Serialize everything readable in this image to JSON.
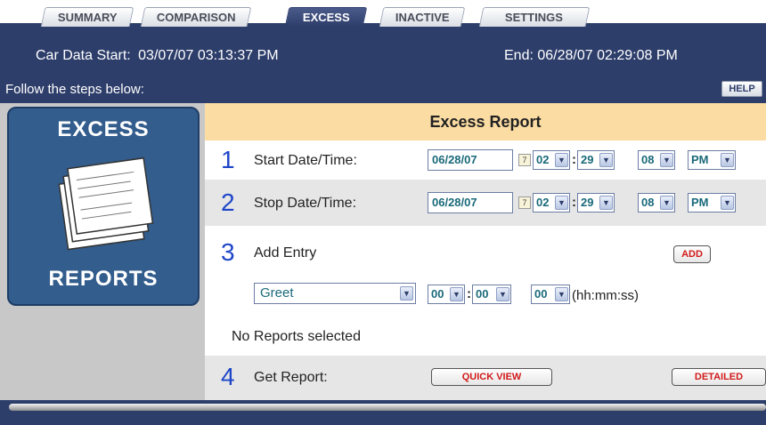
{
  "tabs": [
    {
      "label": "SUMMARY"
    },
    {
      "label": "COMPARISON"
    },
    {
      "label": "EXCESS"
    },
    {
      "label": "INACTIVE"
    },
    {
      "label": "SETTINGS"
    }
  ],
  "active_tab": "EXCESS",
  "header": {
    "car_data_start_label": "Car Data Start:",
    "car_data_start_value": "03/07/07 03:13:37 PM",
    "end_label": "End:",
    "end_value": "06/28/07 02:29:08 PM",
    "follow_text": "Follow the steps below:",
    "help_label": "HELP"
  },
  "left_card": {
    "title": "EXCESS",
    "footer": "REPORTS"
  },
  "report": {
    "title": "Excess Report",
    "steps": [
      {
        "number": "1",
        "label": "Start Date/Time:",
        "date": "06/28/07",
        "hour": "02",
        "minute": "29",
        "second": "08",
        "ampm": "PM"
      },
      {
        "number": "2",
        "label": "Stop Date/Time:",
        "date": "06/28/07",
        "hour": "02",
        "minute": "29",
        "second": "08",
        "ampm": "PM"
      },
      {
        "number": "3",
        "label": "Add Entry",
        "add_label": "ADD",
        "entry_type": "Greet",
        "hh": "00",
        "mm": "00",
        "ss": "00",
        "hms_label": "(hh:mm:ss)",
        "no_reports_text": "No Reports selected"
      },
      {
        "number": "4",
        "label": "Get Report:",
        "quick_view_label": "QUICK VIEW",
        "detailed_label": "DETAILED"
      }
    ]
  },
  "colors": {
    "header_bg": "#2e3e6b",
    "title_band": "#fbdca3",
    "step_number": "#1e46c8",
    "button_text": "#d11a1a",
    "field_text": "#1a6a7a"
  }
}
